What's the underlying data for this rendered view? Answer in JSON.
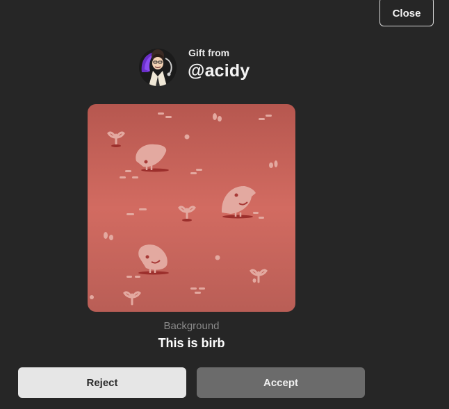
{
  "header": {
    "close_label": "Close"
  },
  "gift": {
    "from_label": "Gift from",
    "username": "@acidy",
    "avatar_icon": "user-avatar-icon"
  },
  "item": {
    "type_label": "Background",
    "name": "This is birb",
    "preview_icon": "birb-pattern-background",
    "colors": {
      "background_top": "#b85a52",
      "background_mid": "#d26b61",
      "pattern": "#e3a9a0",
      "shadow": "#9c2f2c"
    }
  },
  "actions": {
    "reject_label": "Reject",
    "accept_label": "Accept"
  },
  "colors": {
    "page_background": "#262626",
    "reject_button": "#e6e6e6",
    "accept_button": "#6b6b6b"
  }
}
